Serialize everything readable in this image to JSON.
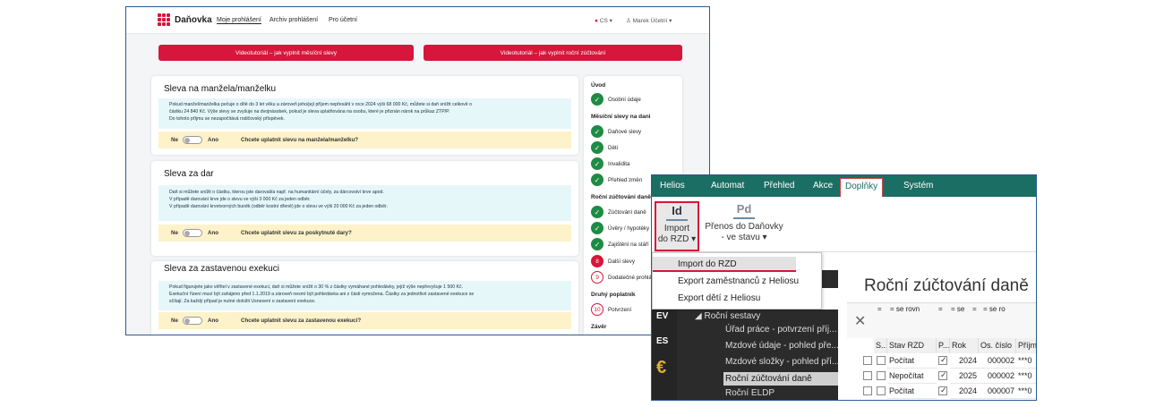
{
  "danovka": {
    "brand": "Daňovka",
    "nav": [
      "Moje prohlášení",
      "Archiv prohlášení",
      "Pro účetní"
    ],
    "lang": "CS",
    "user": "Marek Účetní",
    "buttons": [
      "Videotutoriál – jak vyplnit měsíční slevy",
      "Videotutoriál – jak vyplnit roční zúčtování"
    ],
    "cards": [
      {
        "title": "Sleva na manžela/manželku",
        "info": [
          "Pokud manžel/manželka pečuje o dítě do 3 let věku a zároveň jeho/její příjem nepřesáhl v roce 2024 výši 68 000 Kč, můžete si daň snížit celkově o",
          "částku 24 840 Kč. Výše slevy se zvyšuje na dvojnásobek, pokud je sleva uplatňována na osobu, které je přiznán nárok na průkaz ZTP/P.",
          "Do tohoto příjmu se nezapočítává rodičovský příspěvek."
        ],
        "no": "Ne",
        "yes": "Ano",
        "question": "Chcete uplatnit slevu na manžela/manželku?"
      },
      {
        "title": "Sleva za dar",
        "info": [
          "Daň si můžete snížit o částku, kterou jste darovali/a např. na humanitární účely, za dárcovství krve apod.",
          "V případě darování krve jde o slevu ve výši 3 000 Kč za jeden odběr.",
          "V případě darování krvetvorných buněk (odběr kostní dřeně) jde o slevu ve výši 20 000 Kč za jeden odběr."
        ],
        "no": "Ne",
        "yes": "Ano",
        "question": "Chcete uplatnit slevu za poskytnuté dary?"
      },
      {
        "title": "Sleva za zastavenou exekuci",
        "info": [
          "Pokud figurujete jako věřitel v zastavené exekuci, daň si můžete snížit o 30 % z částky vymáhané pohledávky, jejíž výše nepřevyšuje 1 500 Kč.",
          "Exekuční řízení musí být zahájeno před 1.1.2019 a zároveň nesmí být pohledávka ani z části vymožena. Částky za jednotlivé zastavené exekuce se",
          "sčítají. Za každý případ je nutné doložit Usnesení o zastavení exekuce."
        ],
        "no": "Ne",
        "yes": "Ano",
        "question": "Chcete uplatnit slevu za zastavenou exekuci?"
      }
    ],
    "sidebar": [
      {
        "kind": "header",
        "label": "Úvod"
      },
      {
        "kind": "done",
        "label": "Osobní údaje"
      },
      {
        "kind": "header",
        "label": "Měsíční slevy na dani"
      },
      {
        "kind": "done",
        "label": "Daňové slevy"
      },
      {
        "kind": "done",
        "label": "Děti"
      },
      {
        "kind": "done",
        "label": "Invalidita"
      },
      {
        "kind": "done",
        "label": "Přehled změn"
      },
      {
        "kind": "header",
        "label": "Roční zúčtování daně"
      },
      {
        "kind": "done",
        "label": "Zúčtování daně"
      },
      {
        "kind": "done",
        "label": "Úvěry / hypotéky"
      },
      {
        "kind": "done",
        "label": "Zajištění na stáří"
      },
      {
        "kind": "current",
        "num": "8",
        "label": "Další slevy"
      },
      {
        "kind": "todo",
        "num": "9",
        "label": "Dodatečné prohlášení"
      },
      {
        "kind": "header",
        "label": "Druhý poplatník"
      },
      {
        "kind": "todo",
        "num": "10",
        "label": "Potvrzení"
      },
      {
        "kind": "header",
        "label": "Závěr"
      }
    ]
  },
  "helios": {
    "menu": [
      "Helios",
      "Automat",
      "Přehled",
      "Akce",
      "Doplňky",
      "Systém"
    ],
    "ribbon": [
      {
        "icon": "Id",
        "line1": "Import",
        "line2": "do RZD ▾"
      },
      {
        "icon": "Pd",
        "line1": "Přenos do Daňovky",
        "line2": "- ve stavu ▾"
      }
    ],
    "dropdown": [
      "Import do RZD",
      "Export zaměstnanců z Heliosu",
      "Export dětí z Heliosu"
    ],
    "side_icons": [
      "EV",
      "ES",
      "€"
    ],
    "tree_root": "Roční sestavy",
    "tree": [
      "Úřad práce - potvrzení příj...",
      "Mzdové údaje - pohled pře...",
      "Mzdové složky - pohled pří...",
      "Roční zúčtování daně",
      "Roční ELDP"
    ],
    "title": "Roční zúčtování daně",
    "filters": [
      "=",
      "= se rovn",
      "=",
      "= se",
      "=",
      "= se ro"
    ],
    "columns": [
      "S...",
      "Stav RZD",
      "P...",
      "Rok",
      "Os. číslo",
      "Příjm"
    ],
    "rows": [
      {
        "stav": "Počítat",
        "checked": true,
        "rok": "2024",
        "os": "000002",
        "prijm": "***0"
      },
      {
        "stav": "Nepočítat",
        "checked": true,
        "rok": "2025",
        "os": "000002",
        "prijm": "***0"
      },
      {
        "stav": "Počítat",
        "checked": true,
        "rok": "2024",
        "os": "000007",
        "prijm": "***0"
      }
    ],
    "accent": "#1b6e63"
  }
}
